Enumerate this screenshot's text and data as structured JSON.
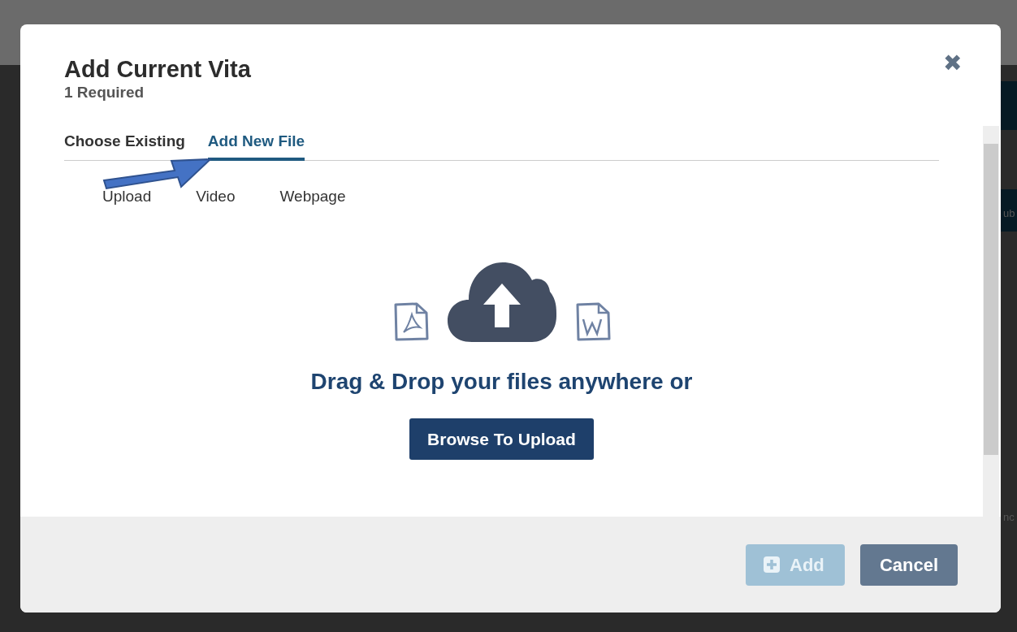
{
  "background": {
    "fragments": [
      "ub",
      "nc"
    ]
  },
  "modal": {
    "title": "Add Current Vita",
    "subtitle": "1 Required",
    "close": "✖"
  },
  "tabs": [
    {
      "label": "Choose Existing",
      "selected": false
    },
    {
      "label": "Add New File",
      "selected": true
    }
  ],
  "subtabs": [
    {
      "label": "Upload"
    },
    {
      "label": "Video"
    },
    {
      "label": "Webpage"
    }
  ],
  "dropzone": {
    "message": "Drag & Drop your files anywhere or",
    "browse_button": "Browse To Upload"
  },
  "footer": {
    "buttons": [
      {
        "label": "Add",
        "kind": "add",
        "disabled": true
      },
      {
        "label": "Cancel",
        "kind": "cancel",
        "disabled": false
      }
    ]
  }
}
